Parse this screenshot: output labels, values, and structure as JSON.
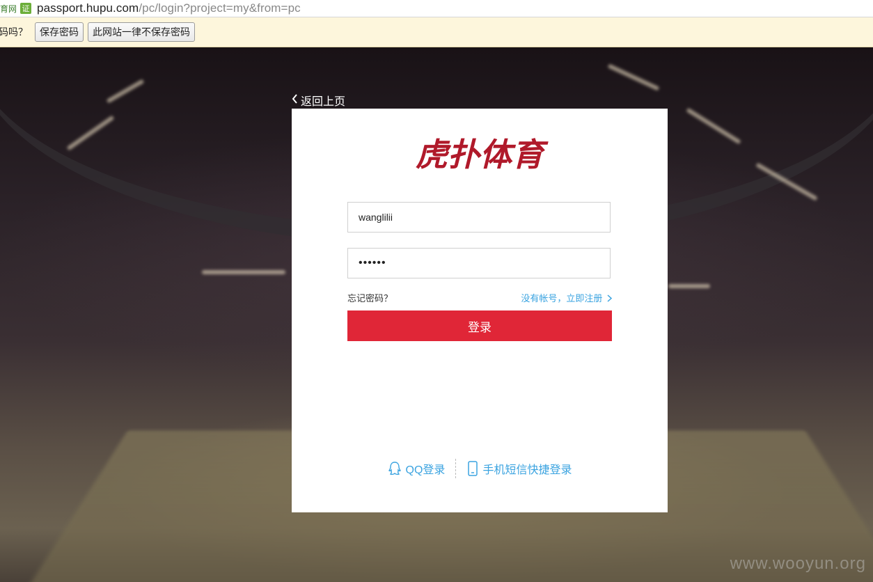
{
  "browser": {
    "site_tag": "育网",
    "cert_badge": "证",
    "url_host": "passport.hupu.com",
    "url_path": "/pc/login?project=my&from=pc"
  },
  "save_password_bar": {
    "question": "码吗？",
    "save_label": "保存密码",
    "never_label": "此网站一律不保存密码"
  },
  "back_link": {
    "label": "返回上页"
  },
  "brand": {
    "logo_text": "虎扑体育",
    "color": "#b0192a"
  },
  "form": {
    "username_value": "wanglilii",
    "password_value": "••••••",
    "forgot_label": "忘记密码？",
    "register_label": "没有帐号，立即注册",
    "login_label": "登录",
    "login_color": "#e02637"
  },
  "alt_login": {
    "qq_label": "QQ登录",
    "sms_label": "手机短信快捷登录",
    "link_color": "#3aa3e0"
  },
  "watermark": "www.wooyun.org"
}
